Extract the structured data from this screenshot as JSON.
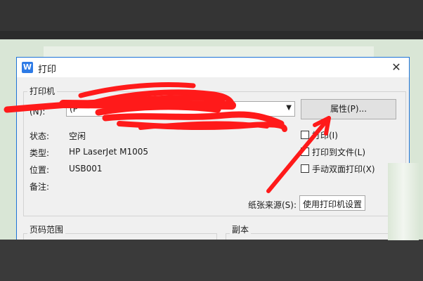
{
  "dialog": {
    "title": "打印",
    "app_icon_letter": "W",
    "close_symbol": "✕"
  },
  "printer_group": {
    "label": "打印机",
    "name_label_partial": "(N):",
    "name_value_partial": "(P",
    "properties_button": "属性(P)...",
    "status_label": "状态:",
    "status_value": "空闲",
    "type_label": "类型:",
    "type_value": "HP LaserJet M1005",
    "location_label": "位置:",
    "location_value": "USB001",
    "comment_label": "备注:",
    "comment_value": ""
  },
  "options": {
    "print_to_file_partial": "打印(I)",
    "print_to_file": "打印到文件(L)",
    "manual_duplex": "手动双面打印(X)"
  },
  "paper_source": {
    "label": "纸张来源(S):",
    "value": "使用打印机设置"
  },
  "page_range_group": {
    "label": "页码范围"
  },
  "copies_group": {
    "label": "副本"
  },
  "colors": {
    "accent": "#1e73d8",
    "annotation": "#ff1a1a"
  }
}
